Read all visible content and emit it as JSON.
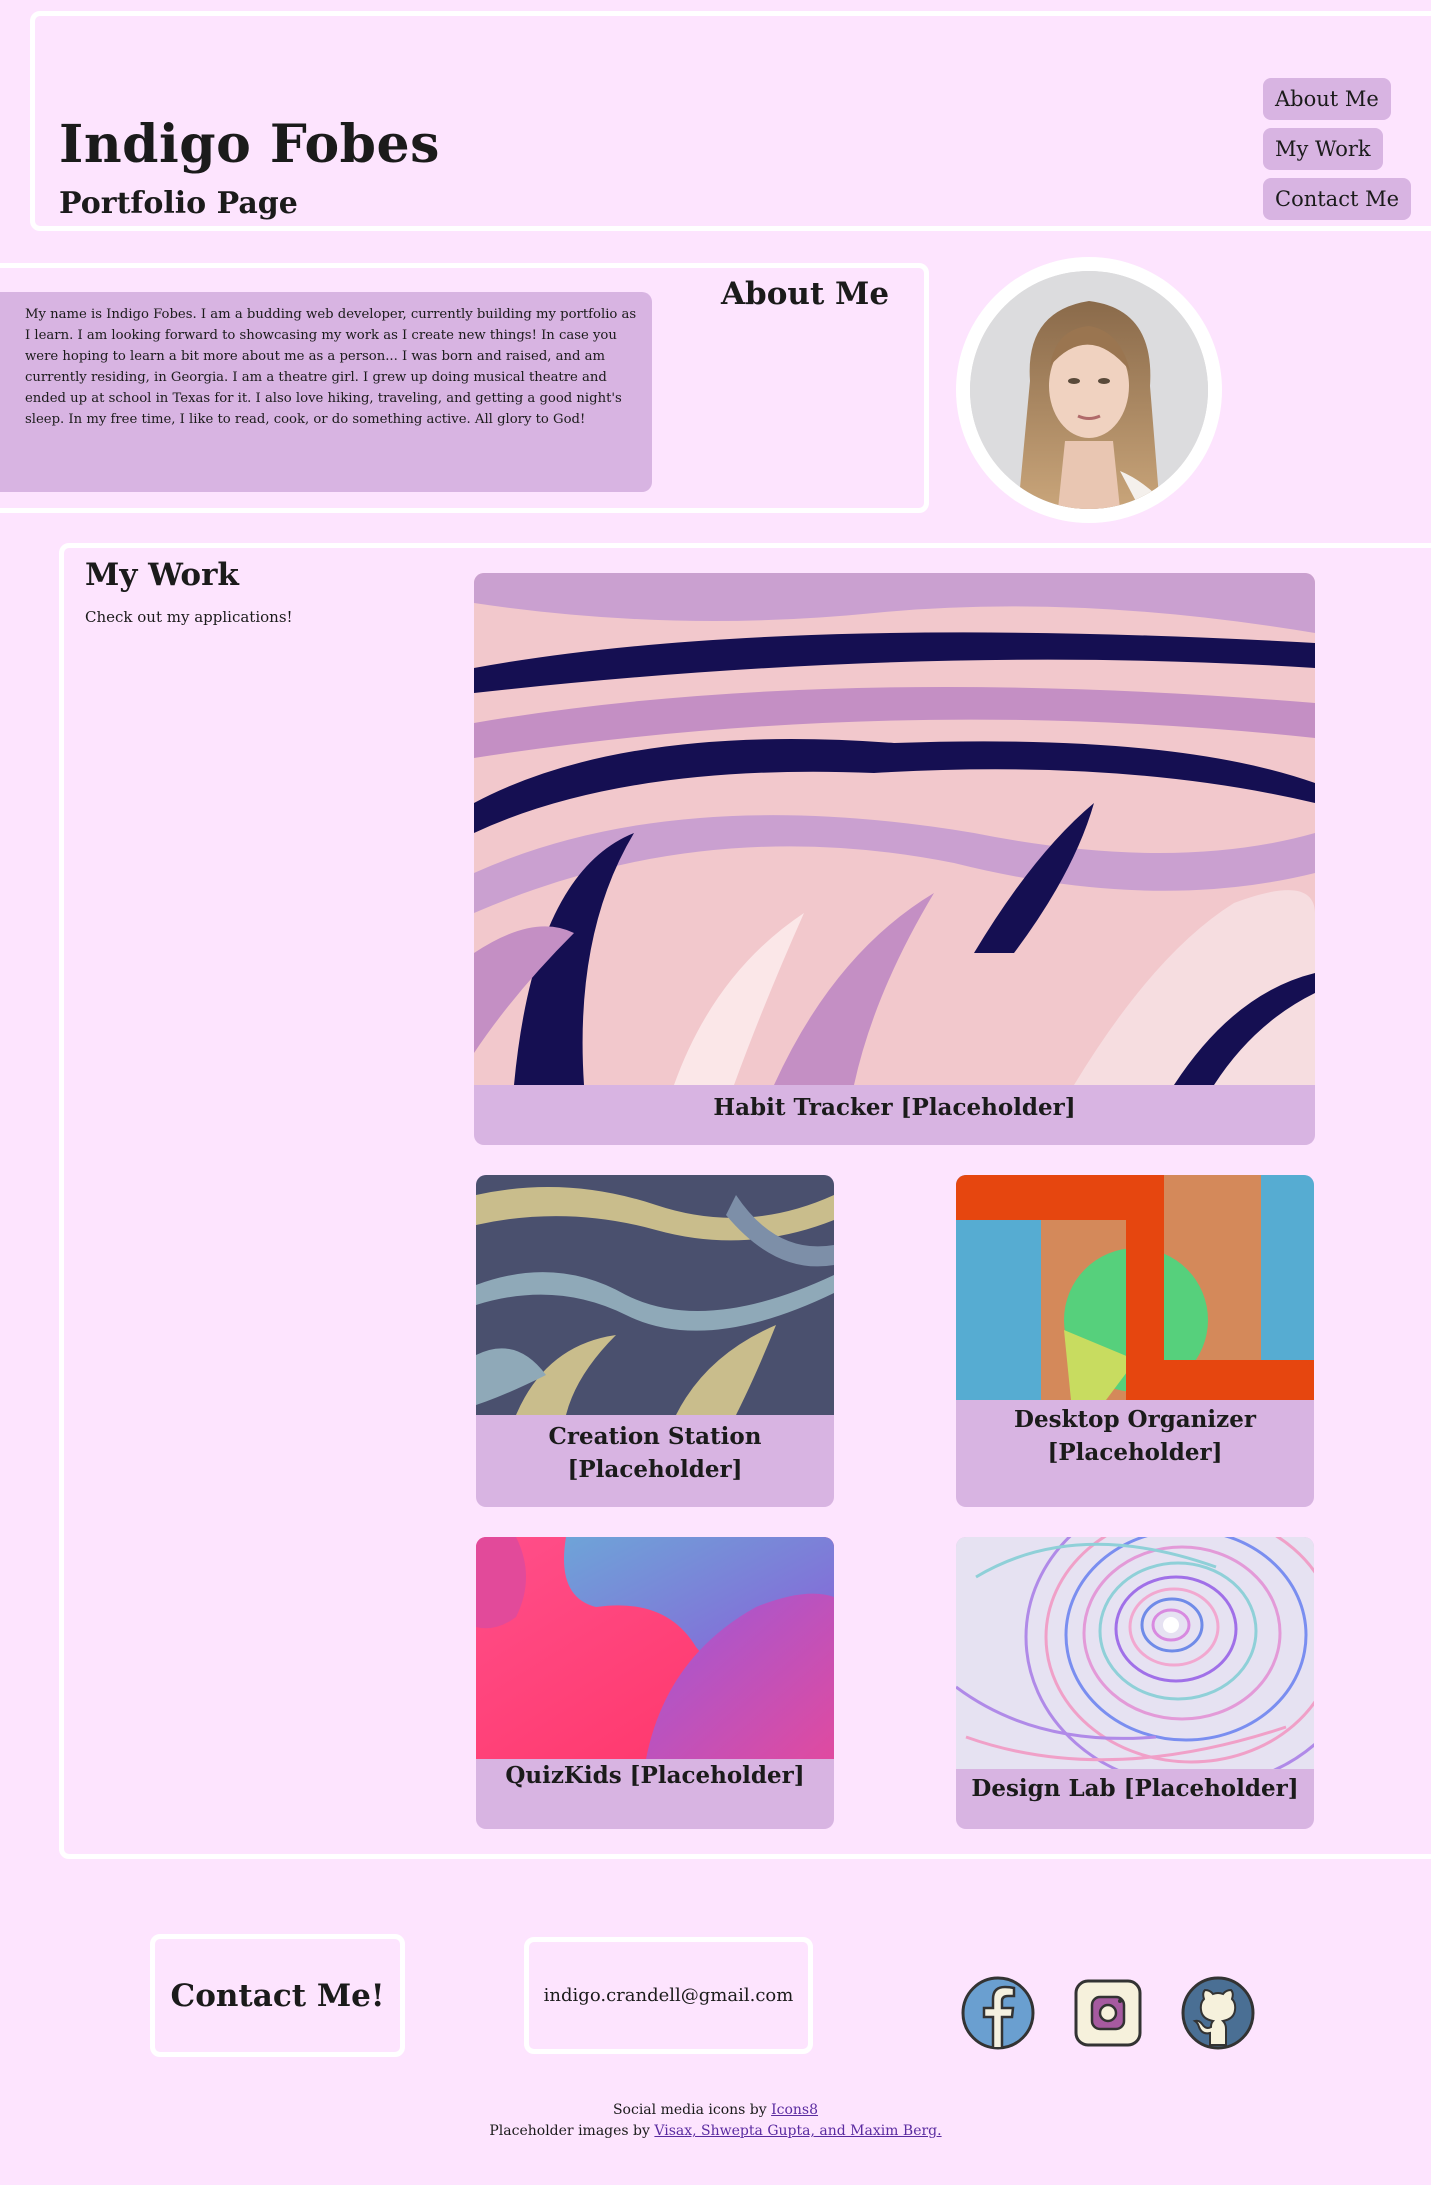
{
  "header": {
    "title": "Indigo Fobes",
    "subtitle": "Portfolio Page",
    "nav": [
      {
        "label": "About Me"
      },
      {
        "label": "My Work"
      },
      {
        "label": "Contact Me"
      }
    ]
  },
  "about": {
    "heading": "About Me",
    "text": "My name is Indigo Fobes. I am a budding web developer, currently building my portfolio as I learn. I am looking forward to showcasing my work as I create new things! In case you were hoping to learn a bit more about me as a person... I was born and raised, and am currently residing, in Georgia. I am a theatre girl. I grew up doing musical theatre and ended up at school in Texas for it. I also love hiking, traveling, and getting a good night's sleep. In my free time, I like to read, cook, or do something active. All glory to God!"
  },
  "work": {
    "heading": "My Work",
    "intro": "Check out my applications!",
    "projects": [
      {
        "title": "Habit Tracker [Placeholder]"
      },
      {
        "title": "Creation Station [Placeholder]"
      },
      {
        "title": "Desktop Organizer [Placeholder]"
      },
      {
        "title": "QuizKids [Placeholder]"
      },
      {
        "title": "Design Lab [Placeholder]"
      }
    ]
  },
  "contact": {
    "heading": "Contact Me!",
    "email": "indigo.crandell@gmail.com",
    "social": [
      "facebook-icon",
      "instagram-icon",
      "github-icon"
    ]
  },
  "credits": {
    "icons_prefix": "Social media icons by ",
    "icons_link": "Icons8",
    "images_prefix": "Placeholder images by ",
    "images_link": "Visax, Shwepta Gupta, and Maxim Berg."
  },
  "colors": {
    "background": "#fde4fe",
    "card": "#d8b4e2",
    "border": "#ffffff"
  }
}
